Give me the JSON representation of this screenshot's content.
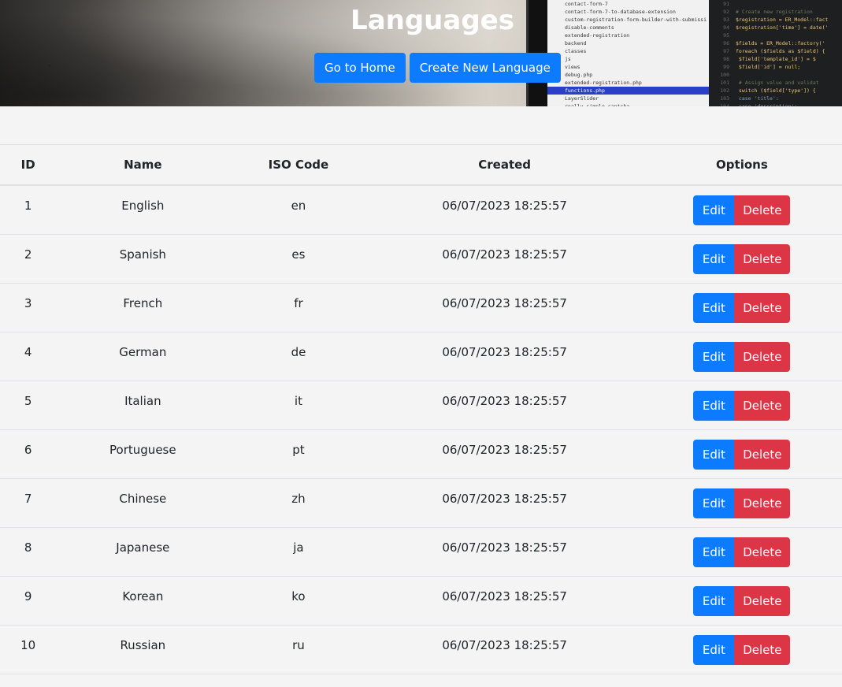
{
  "header": {
    "title": "Languages",
    "buttons": {
      "home": "Go to Home",
      "create": "Create New Language"
    }
  },
  "background": {
    "explorer_items": [
      "contact-form-7",
      "contact-form-7-to-database-extension",
      "custom-registration-form-builder-with-submissi",
      "disable-comments",
      "extended-registration",
      "backend",
      "classes",
      "js",
      "views",
      "debug.php",
      "extended-registration.php",
      "functions.php",
      "LayerSlider",
      "really-simple-captcha"
    ],
    "code_lines": [
      {
        "n": "91",
        "t": ""
      },
      {
        "n": "92",
        "t": "# Create new registration"
      },
      {
        "n": "93",
        "t": "$registration = ER_Model::fact"
      },
      {
        "n": "94",
        "t": "$registration['time'] = date('"
      },
      {
        "n": "95",
        "t": ""
      },
      {
        "n": "96",
        "t": "$fields = ER_Model::factory('"
      },
      {
        "n": "97",
        "t": "foreach ($fields as $field) {"
      },
      {
        "n": "98",
        "t": "    $field['template_id'] = $"
      },
      {
        "n": "99",
        "t": "    $field['id'] = null;"
      },
      {
        "n": "100",
        "t": ""
      },
      {
        "n": "101",
        "t": "    # Assign value and validat"
      },
      {
        "n": "102",
        "t": "    switch ($field['type']) {"
      },
      {
        "n": "103",
        "t": "        case 'title':"
      },
      {
        "n": "104",
        "t": "        case 'description':"
      }
    ]
  },
  "table": {
    "headers": [
      "ID",
      "Name",
      "ISO Code",
      "Created",
      "Options"
    ],
    "rows": [
      {
        "id": "1",
        "name": "English",
        "iso": "en",
        "created": "06/07/2023 18:25:57"
      },
      {
        "id": "2",
        "name": "Spanish",
        "iso": "es",
        "created": "06/07/2023 18:25:57"
      },
      {
        "id": "3",
        "name": "French",
        "iso": "fr",
        "created": "06/07/2023 18:25:57"
      },
      {
        "id": "4",
        "name": "German",
        "iso": "de",
        "created": "06/07/2023 18:25:57"
      },
      {
        "id": "5",
        "name": "Italian",
        "iso": "it",
        "created": "06/07/2023 18:25:57"
      },
      {
        "id": "6",
        "name": "Portuguese",
        "iso": "pt",
        "created": "06/07/2023 18:25:57"
      },
      {
        "id": "7",
        "name": "Chinese",
        "iso": "zh",
        "created": "06/07/2023 18:25:57"
      },
      {
        "id": "8",
        "name": "Japanese",
        "iso": "ja",
        "created": "06/07/2023 18:25:57"
      },
      {
        "id": "9",
        "name": "Korean",
        "iso": "ko",
        "created": "06/07/2023 18:25:57"
      },
      {
        "id": "10",
        "name": "Russian",
        "iso": "ru",
        "created": "06/07/2023 18:25:57"
      }
    ],
    "actions": {
      "edit": "Edit",
      "delete": "Delete"
    }
  },
  "colors": {
    "primary": "#0d7bff",
    "danger": "#dc3545",
    "page_background": "#f4f4f4"
  }
}
